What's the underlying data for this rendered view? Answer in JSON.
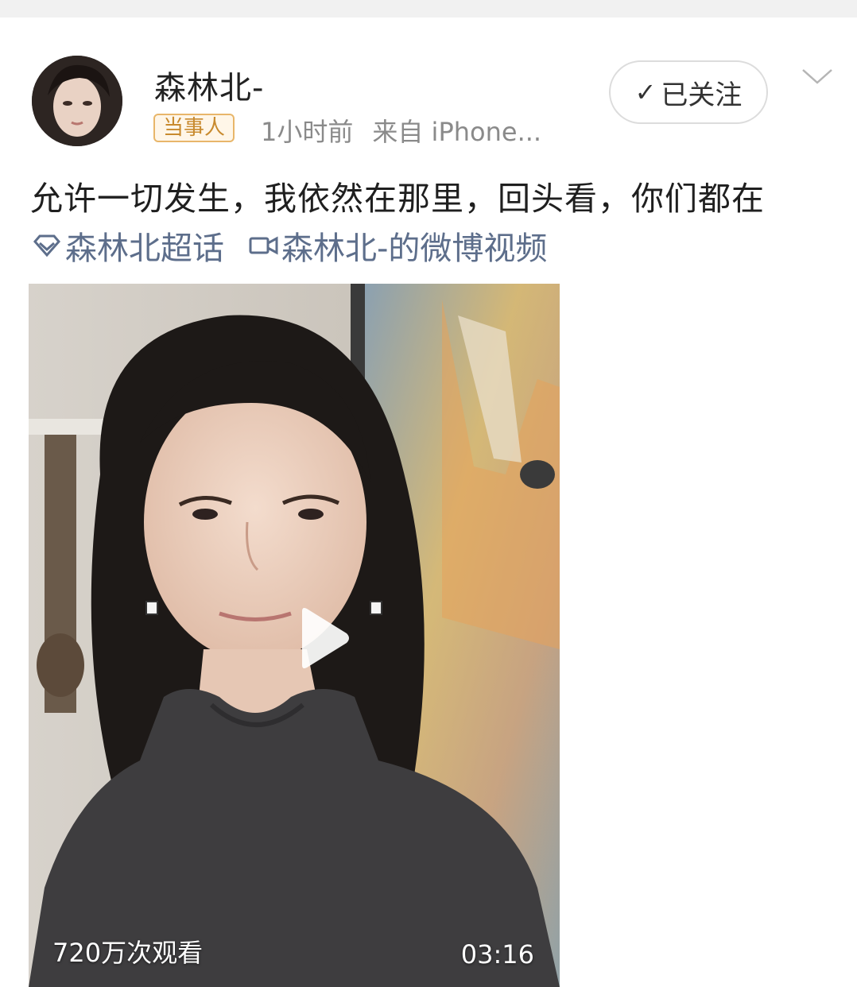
{
  "post": {
    "username": "森林北-",
    "badge": "当事人",
    "time": "1小时前",
    "source": "来自 iPhone...",
    "follow_label": "已关注",
    "text": "允许一切发生，我依然在那里，回头看，你们都在",
    "topic_link": "森林北超话",
    "video_link": "森林北-的微博视频"
  },
  "video": {
    "views": "720万次观看",
    "duration": "03:16"
  },
  "icons": {
    "follow": "check-icon",
    "menu": "chevron-down-icon",
    "topic": "diamond-icon",
    "video": "video-camera-icon",
    "play": "play-icon"
  },
  "colors": {
    "link": "#5d6e8b",
    "badge_border": "#e8b66a",
    "badge_text": "#c88a2e",
    "meta": "#8a8a8a"
  }
}
